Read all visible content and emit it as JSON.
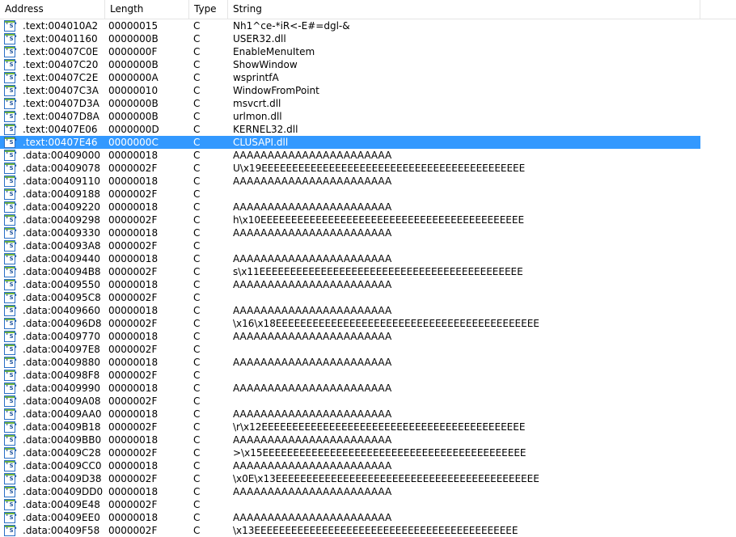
{
  "columns": {
    "address": "Address",
    "length": "Length",
    "type": "Type",
    "string": "String"
  },
  "icon": {
    "name": "string-icon",
    "glyph": "'s'"
  },
  "selected_index": 9,
  "rows": [
    {
      "address": ".text:004010A2",
      "length": "00000015",
      "type": "C",
      "string": "Nh1^ce-*iR<-E#=dgl-&"
    },
    {
      "address": ".text:00401160",
      "length": "0000000B",
      "type": "C",
      "string": "USER32.dll"
    },
    {
      "address": ".text:00407C0E",
      "length": "0000000F",
      "type": "C",
      "string": "EnableMenuItem"
    },
    {
      "address": ".text:00407C20",
      "length": "0000000B",
      "type": "C",
      "string": "ShowWindow"
    },
    {
      "address": ".text:00407C2E",
      "length": "0000000A",
      "type": "C",
      "string": "wsprintfA"
    },
    {
      "address": ".text:00407C3A",
      "length": "00000010",
      "type": "C",
      "string": "WindowFromPoint"
    },
    {
      "address": ".text:00407D3A",
      "length": "0000000B",
      "type": "C",
      "string": "msvcrt.dll"
    },
    {
      "address": ".text:00407D8A",
      "length": "0000000B",
      "type": "C",
      "string": "urlmon.dll"
    },
    {
      "address": ".text:00407E06",
      "length": "0000000D",
      "type": "C",
      "string": "KERNEL32.dll"
    },
    {
      "address": ".text:00407E46",
      "length": "0000000C",
      "type": "C",
      "string": "CLUSAPI.dll"
    },
    {
      "address": ".data:00409000",
      "length": "00000018",
      "type": "C",
      "string": "AAAAAAAAAAAAAAAAAAAAAAA"
    },
    {
      "address": ".data:00409078",
      "length": "0000002F",
      "type": "C",
      "string": "U\\x19EEEEEEEEEEEEEEEEEEEEEEEEEEEEEEEEEEEEEEEEEEE"
    },
    {
      "address": ".data:00409110",
      "length": "00000018",
      "type": "C",
      "string": "AAAAAAAAAAAAAAAAAAAAAAA"
    },
    {
      "address": ".data:00409188",
      "length": "0000002F",
      "type": "C",
      "string": ""
    },
    {
      "address": ".data:00409220",
      "length": "00000018",
      "type": "C",
      "string": "AAAAAAAAAAAAAAAAAAAAAAA"
    },
    {
      "address": ".data:00409298",
      "length": "0000002F",
      "type": "C",
      "string": "h\\x10EEEEEEEEEEEEEEEEEEEEEEEEEEEEEEEEEEEEEEEEEEE"
    },
    {
      "address": ".data:00409330",
      "length": "00000018",
      "type": "C",
      "string": "AAAAAAAAAAAAAAAAAAAAAAA"
    },
    {
      "address": ".data:004093A8",
      "length": "0000002F",
      "type": "C",
      "string": ""
    },
    {
      "address": ".data:00409440",
      "length": "00000018",
      "type": "C",
      "string": "AAAAAAAAAAAAAAAAAAAAAAA"
    },
    {
      "address": ".data:004094B8",
      "length": "0000002F",
      "type": "C",
      "string": "s\\x11EEEEEEEEEEEEEEEEEEEEEEEEEEEEEEEEEEEEEEEEEEE"
    },
    {
      "address": ".data:00409550",
      "length": "00000018",
      "type": "C",
      "string": "AAAAAAAAAAAAAAAAAAAAAAA"
    },
    {
      "address": ".data:004095C8",
      "length": "0000002F",
      "type": "C",
      "string": ""
    },
    {
      "address": ".data:00409660",
      "length": "00000018",
      "type": "C",
      "string": "AAAAAAAAAAAAAAAAAAAAAAA"
    },
    {
      "address": ".data:004096D8",
      "length": "0000002F",
      "type": "C",
      "string": "\\x16\\x18EEEEEEEEEEEEEEEEEEEEEEEEEEEEEEEEEEEEEEEEEEE"
    },
    {
      "address": ".data:00409770",
      "length": "00000018",
      "type": "C",
      "string": "AAAAAAAAAAAAAAAAAAAAAAA"
    },
    {
      "address": ".data:004097E8",
      "length": "0000002F",
      "type": "C",
      "string": ""
    },
    {
      "address": ".data:00409880",
      "length": "00000018",
      "type": "C",
      "string": "AAAAAAAAAAAAAAAAAAAAAAA"
    },
    {
      "address": ".data:004098F8",
      "length": "0000002F",
      "type": "C",
      "string": ""
    },
    {
      "address": ".data:00409990",
      "length": "00000018",
      "type": "C",
      "string": "AAAAAAAAAAAAAAAAAAAAAAA"
    },
    {
      "address": ".data:00409A08",
      "length": "0000002F",
      "type": "C",
      "string": ""
    },
    {
      "address": ".data:00409AA0",
      "length": "00000018",
      "type": "C",
      "string": "AAAAAAAAAAAAAAAAAAAAAAA"
    },
    {
      "address": ".data:00409B18",
      "length": "0000002F",
      "type": "C",
      "string": "\\r\\x12EEEEEEEEEEEEEEEEEEEEEEEEEEEEEEEEEEEEEEEEEEE"
    },
    {
      "address": ".data:00409BB0",
      "length": "00000018",
      "type": "C",
      "string": "AAAAAAAAAAAAAAAAAAAAAAA"
    },
    {
      "address": ".data:00409C28",
      "length": "0000002F",
      "type": "C",
      "string": ">\\x15EEEEEEEEEEEEEEEEEEEEEEEEEEEEEEEEEEEEEEEEEEE"
    },
    {
      "address": ".data:00409CC0",
      "length": "00000018",
      "type": "C",
      "string": "AAAAAAAAAAAAAAAAAAAAAAA"
    },
    {
      "address": ".data:00409D38",
      "length": "0000002F",
      "type": "C",
      "string": "\\x0E\\x13EEEEEEEEEEEEEEEEEEEEEEEEEEEEEEEEEEEEEEEEEEE"
    },
    {
      "address": ".data:00409DD0",
      "length": "00000018",
      "type": "C",
      "string": "AAAAAAAAAAAAAAAAAAAAAAA"
    },
    {
      "address": ".data:00409E48",
      "length": "0000002F",
      "type": "C",
      "string": ""
    },
    {
      "address": ".data:00409EE0",
      "length": "00000018",
      "type": "C",
      "string": "AAAAAAAAAAAAAAAAAAAAAAA"
    },
    {
      "address": ".data:00409F58",
      "length": "0000002F",
      "type": "C",
      "string": " \\x13EEEEEEEEEEEEEEEEEEEEEEEEEEEEEEEEEEEEEEEEEEE"
    }
  ]
}
